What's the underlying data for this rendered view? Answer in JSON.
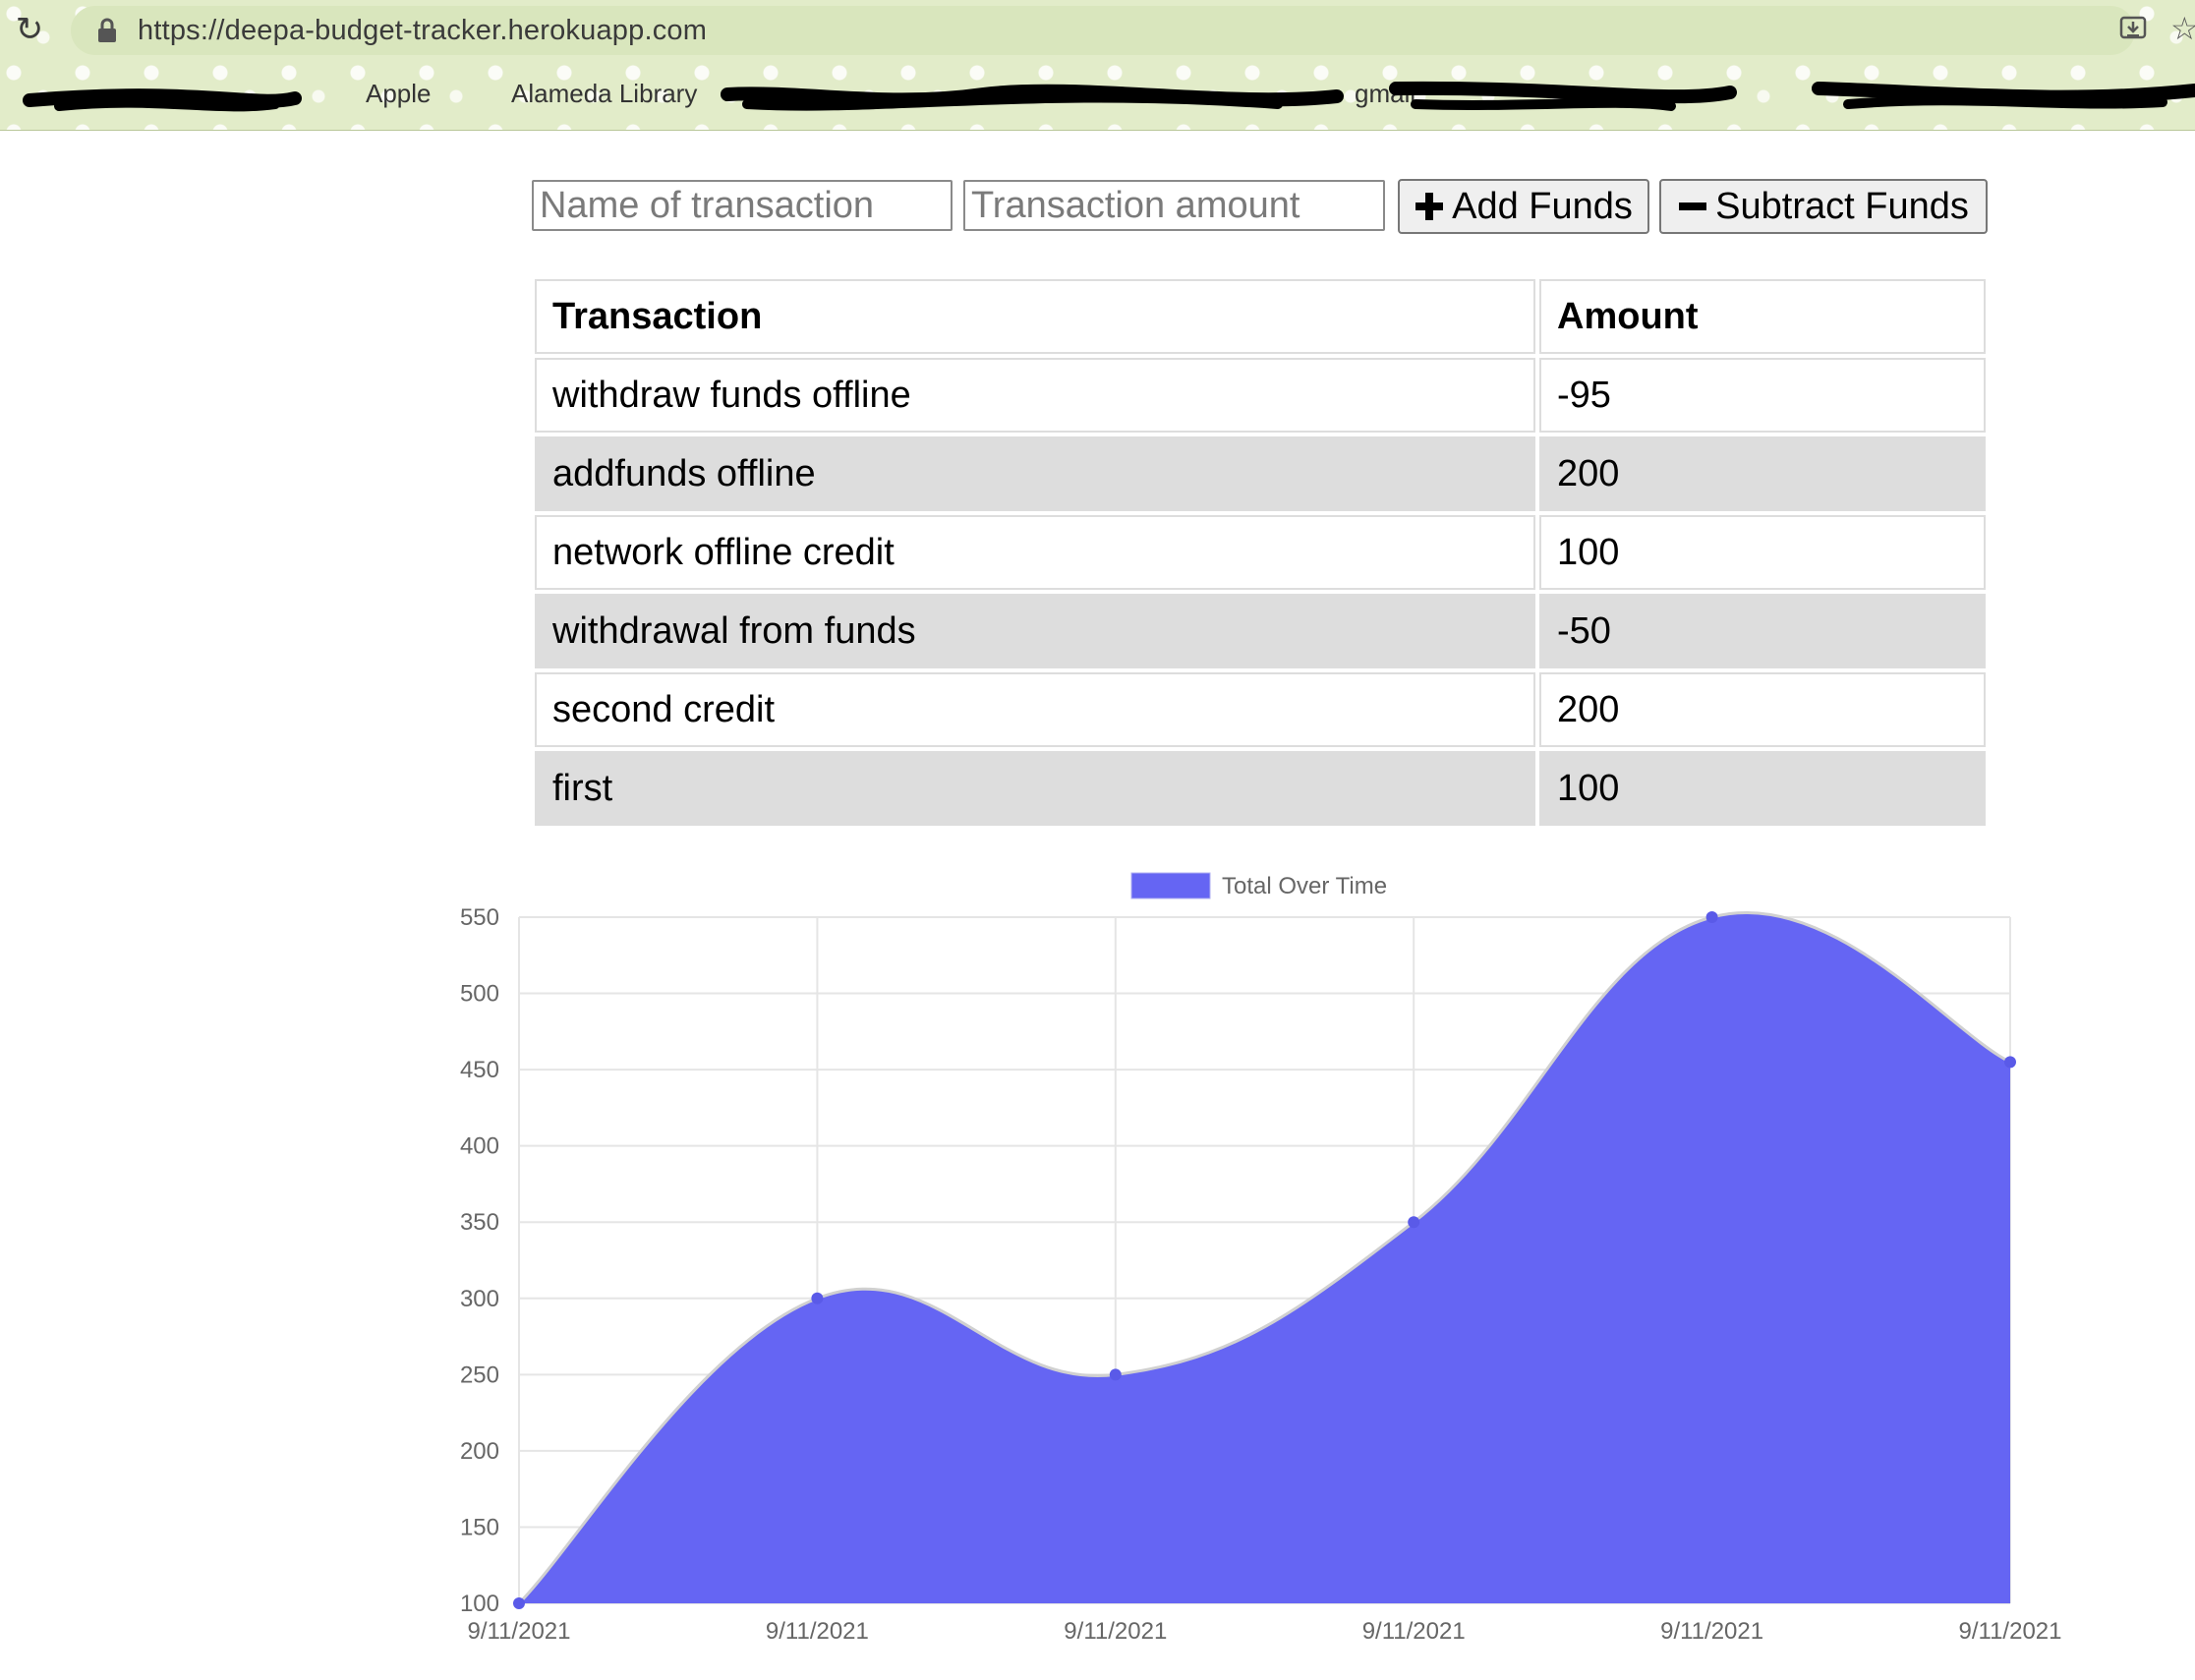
{
  "browser": {
    "url": "https://deepa-budget-tracker.herokuapp.com",
    "bookmarks": [
      "Apple",
      "Alameda Library",
      "gmail"
    ]
  },
  "form": {
    "name_placeholder": "Name of transaction",
    "amount_placeholder": "Transaction amount",
    "add_label": "Add Funds",
    "subtract_label": "Subtract Funds"
  },
  "table": {
    "headers": [
      "Transaction",
      "Amount"
    ],
    "rows": [
      {
        "name": "withdraw funds offline",
        "amount": "-95"
      },
      {
        "name": "addfunds offline",
        "amount": "200"
      },
      {
        "name": "network offline credit",
        "amount": "100"
      },
      {
        "name": "withdrawal from funds",
        "amount": "-50"
      },
      {
        "name": "second credit",
        "amount": "200"
      },
      {
        "name": "first",
        "amount": "100"
      }
    ]
  },
  "chart_data": {
    "type": "area",
    "title": "",
    "xlabel": "",
    "ylabel": "",
    "categories": [
      "9/11/2021",
      "9/11/2021",
      "9/11/2021",
      "9/11/2021",
      "9/11/2021",
      "9/11/2021"
    ],
    "series": [
      {
        "name": "Total Over Time",
        "values": [
          100,
          300,
          250,
          350,
          550,
          455
        ]
      }
    ],
    "yticks": [
      100,
      150,
      200,
      250,
      300,
      350,
      400,
      450,
      500,
      550
    ],
    "ylim": [
      100,
      550
    ],
    "grid": true,
    "legend": "top-center",
    "colors": {
      "fill": "#6565f3",
      "line": "#d0d0d0",
      "point": "#5a5ae8",
      "grid": "#e5e5e5"
    }
  }
}
